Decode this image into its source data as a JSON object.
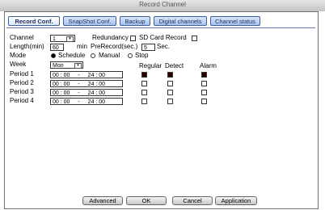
{
  "window": {
    "title": "Record Channel"
  },
  "tabs": [
    {
      "label": "Record Conf."
    },
    {
      "label": "SnapShot Conf."
    },
    {
      "label": "Backup"
    },
    {
      "label": "Digital channels"
    },
    {
      "label": "Channel status"
    }
  ],
  "form": {
    "channel": {
      "label": "Channel",
      "value": "1"
    },
    "redundancy": {
      "label": "Redundancy",
      "checked": false
    },
    "sdcard": {
      "label": "SD Card Record",
      "checked": false
    },
    "length": {
      "label": "Length(min)",
      "value": "60",
      "unit": "min"
    },
    "prerecord": {
      "label": "PreRecord(sec.)",
      "value": "5",
      "unit": "Sec."
    },
    "mode": {
      "label": "Mode",
      "options": [
        "Schedule",
        "Manual",
        "Stop"
      ],
      "selected": "Schedule"
    },
    "week": {
      "label": "Week",
      "value": "Mon"
    }
  },
  "columns": {
    "regular": "Regular",
    "detect": "Detect",
    "alarm": "Alarm"
  },
  "periods": [
    {
      "label": "Period 1",
      "start": "00 : 00",
      "dash": "-",
      "end": "24 : 00",
      "regular": true,
      "detect": true,
      "alarm": true
    },
    {
      "label": "Period 2",
      "start": "00 : 00",
      "dash": "-",
      "end": "24 : 00",
      "regular": false,
      "detect": false,
      "alarm": false
    },
    {
      "label": "Period 3",
      "start": "00 : 00",
      "dash": "-",
      "end": "24 : 00",
      "regular": false,
      "detect": false,
      "alarm": false
    },
    {
      "label": "Period 4",
      "start": "00 : 00",
      "dash": "-",
      "end": "24 : 00",
      "regular": false,
      "detect": false,
      "alarm": false
    }
  ],
  "buttons": {
    "advanced": "Advanced",
    "ok": "OK",
    "cancel": "Cancel",
    "apply": "Application"
  }
}
